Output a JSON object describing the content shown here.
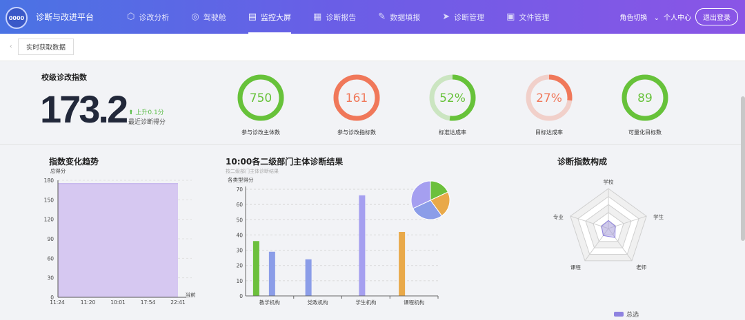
{
  "header": {
    "logo_text": "0000",
    "app_title": "诊断与改进平台",
    "nav": [
      {
        "label": "诊改分析",
        "icon": "cube-icon"
      },
      {
        "label": "驾驶舱",
        "icon": "gauge-icon"
      },
      {
        "label": "监控大屏",
        "icon": "monitor-icon",
        "active": true
      },
      {
        "label": "诊断报告",
        "icon": "report-icon"
      },
      {
        "label": "数据填报",
        "icon": "edit-icon"
      },
      {
        "label": "诊断管理",
        "icon": "send-icon"
      },
      {
        "label": "文件管理",
        "icon": "file-icon"
      }
    ],
    "role_switch": "角色切换",
    "user_center": "个人中心",
    "logout": "退出登录"
  },
  "toolbar": {
    "realtime_btn": "实时获取数据"
  },
  "summary": {
    "title": "校级诊改指数",
    "value": "173.2",
    "change": "上升0.1分",
    "change_sub": "最近诊断得分",
    "rings": [
      {
        "value": "750",
        "label": "参与诊改主体数",
        "pct": 100,
        "color": "#67c23a"
      },
      {
        "value": "161",
        "label": "参与诊改指标数",
        "pct": 100,
        "color": "#f0785a"
      },
      {
        "value": "52%",
        "label": "标准达成率",
        "pct": 52,
        "color": "#67c23a"
      },
      {
        "value": "27%",
        "label": "目标达成率",
        "pct": 27,
        "color": "#f0785a"
      },
      {
        "value": "89",
        "label": "可量化目标数",
        "pct": 100,
        "color": "#67c23a"
      }
    ]
  },
  "trend": {
    "title": "指数变化趋势",
    "ylabel": "总得分",
    "x_end_label": "当前"
  },
  "dept": {
    "title": "10:00各二级部门主体诊断结果",
    "subtitle": "按二级部门主体诊断结果",
    "ylabel": "各类型得分"
  },
  "radar": {
    "title": "诊断指数构成",
    "legend": "总选"
  },
  "chart_data": [
    {
      "type": "area",
      "title": "指数变化趋势",
      "ylabel": "总得分",
      "categories": [
        "11:24",
        "11:20",
        "10:01",
        "17:54",
        "22:41"
      ],
      "values": [
        175,
        175,
        175,
        175,
        175
      ],
      "ylim": [
        0,
        180
      ],
      "yticks": [
        0,
        30,
        60,
        90,
        120,
        150,
        180
      ]
    },
    {
      "type": "bar",
      "title": "10:00各二级部门主体诊断结果",
      "ylabel": "各类型得分",
      "categories": [
        "教学机构",
        "党政机构",
        "学生机构",
        "课程机构"
      ],
      "ylim": [
        0,
        70
      ],
      "yticks": [
        0,
        10,
        20,
        30,
        40,
        50,
        60,
        70
      ],
      "series": [
        {
          "values": [
            36,
            null,
            null,
            null
          ],
          "color": "#6cc03c"
        },
        {
          "values": [
            29,
            24,
            null,
            null
          ],
          "color": "#8b9de8"
        },
        {
          "values": [
            null,
            null,
            66,
            null
          ],
          "color": "#a59ff0"
        },
        {
          "values": [
            null,
            null,
            null,
            42
          ],
          "color": "#e9a949"
        }
      ]
    },
    {
      "type": "pie",
      "slices": [
        {
          "value": 18,
          "color": "#6cc03c"
        },
        {
          "value": 22,
          "color": "#e9a949"
        },
        {
          "value": 28,
          "color": "#8b9de8"
        },
        {
          "value": 32,
          "color": "#a59ff0"
        }
      ]
    },
    {
      "type": "radar",
      "indicators": [
        "学校",
        "学生",
        "老师",
        "课程",
        "专业"
      ],
      "series": [
        {
          "name": "总选",
          "values": [
            0.2,
            0.18,
            0.28,
            0.22,
            0.18
          ],
          "color": "#8e82e0"
        }
      ]
    }
  ]
}
